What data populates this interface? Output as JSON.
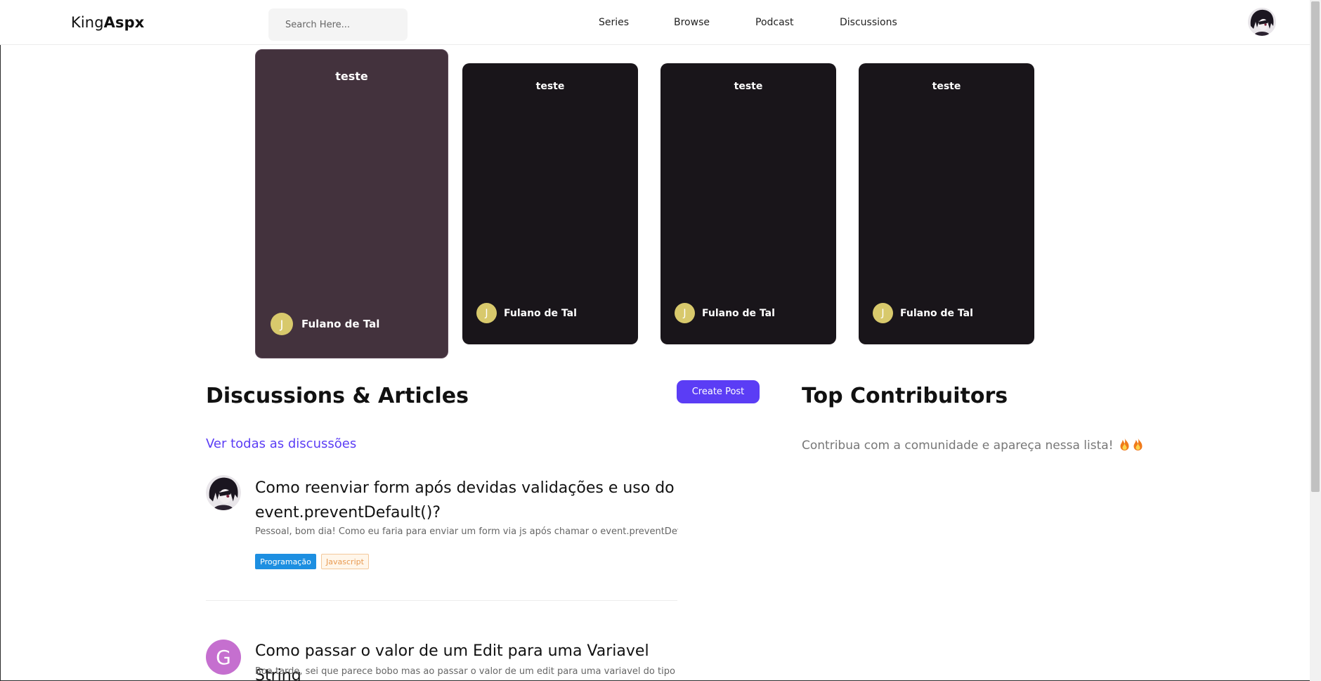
{
  "header": {
    "logo_light": "King",
    "logo_bold": "Aspx",
    "search_placeholder": "Search Here...",
    "nav": [
      "Series",
      "Browse",
      "Podcast",
      "Discussions"
    ]
  },
  "cards": [
    {
      "title": "teste",
      "author": "Fulano de Tal",
      "avatar_letter": "J",
      "active": true
    },
    {
      "title": "teste",
      "author": "Fulano de Tal",
      "avatar_letter": "J",
      "active": false
    },
    {
      "title": "teste",
      "author": "Fulano de Tal",
      "avatar_letter": "J",
      "active": false
    },
    {
      "title": "teste",
      "author": "Fulano de Tal",
      "avatar_letter": "J",
      "active": false
    }
  ],
  "discussions": {
    "heading": "Discussions & Articles",
    "create_button": "Create Post",
    "view_all": "Ver todas as discussões",
    "posts": [
      {
        "title_line1": "Como reenviar form após devidas validações e uso do",
        "title_line2": "event.preventDefault()?",
        "excerpt": "Pessoal, bom dia! Como eu faria para enviar um form via js após chamar o event.preventDefault...",
        "tags": [
          "Programação",
          "Javascript"
        ]
      },
      {
        "avatar_letter": "G",
        "title_line1": "Como passar o valor de um Edit para uma Variavel String",
        "excerpt": "Boa tarde, sei que parece bobo mas ao passar o valor de um edit para uma variavel do tipo Stri..."
      }
    ]
  },
  "contributors": {
    "heading": "Top Contribuitors",
    "note": "Contribua com a comunidade e apareça nessa lista!"
  },
  "colors": {
    "accent": "#5b3df5",
    "card_bg": "#19151a",
    "card_active_bg": "#43323d",
    "avatar_yellow": "#d8c96c",
    "tag_blue": "#1d8fe1"
  }
}
